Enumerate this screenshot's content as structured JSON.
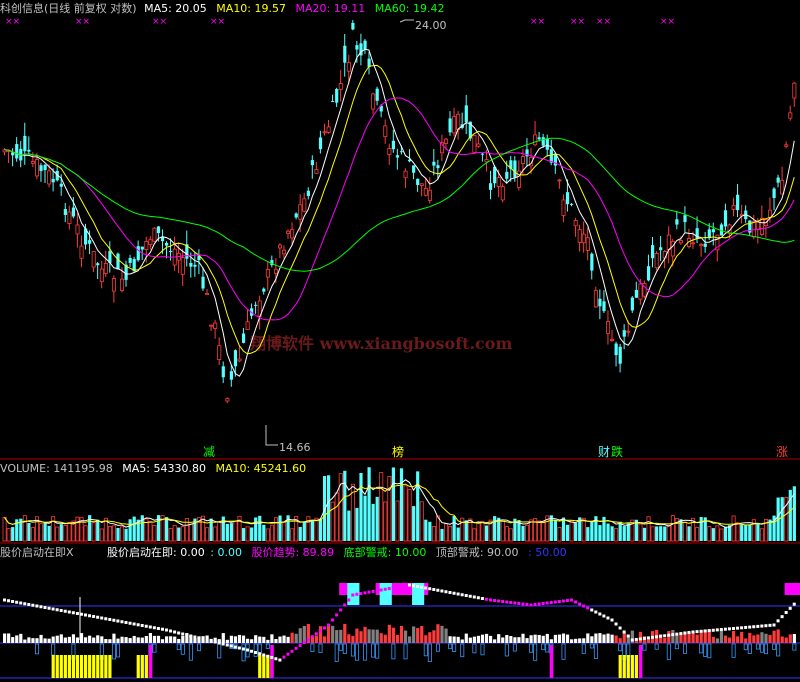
{
  "price_header": {
    "title": "科创信息(日线 前复权 对数)",
    "ma5": "MA5: 20.05",
    "ma10": "MA10: 19.57",
    "ma20": "MA20: 19.11",
    "ma60": "MA60: 19.42"
  },
  "price_panel": {
    "high_label": "24.00",
    "low_label": "14.66",
    "watermark": "翔博软件 www.xiangbosoft.com",
    "event_tags": [
      "减",
      "榜",
      "财",
      "跌",
      "涨"
    ],
    "top_markers": "××"
  },
  "volume_header": {
    "volume": "VOLUME: 141195.98",
    "ma5": "MA5: 54330.80",
    "ma10": "MA10: 45241.60"
  },
  "indicator_header": {
    "name": "股价启动在即X",
    "start": "股价启动在即: 0.00",
    "zero": ": 0.00",
    "trend": "股价趋势: 89.89",
    "bottom": "底部警戒: 10.00",
    "top": "顶部警戒: 90.00",
    "mid": ": 50.00"
  },
  "colors": {
    "up": "#ff3c3c",
    "down": "#54ffff",
    "ma5": "#ffffff",
    "ma10": "#ffff00",
    "ma20": "#ff00ff",
    "ma60": "#00ff00",
    "frame": "#b00000",
    "gridline": "#3333ff",
    "yellow_bar": "#ffff00",
    "magenta_bar": "#ff00ff",
    "gray_bar": "#808080"
  }
}
